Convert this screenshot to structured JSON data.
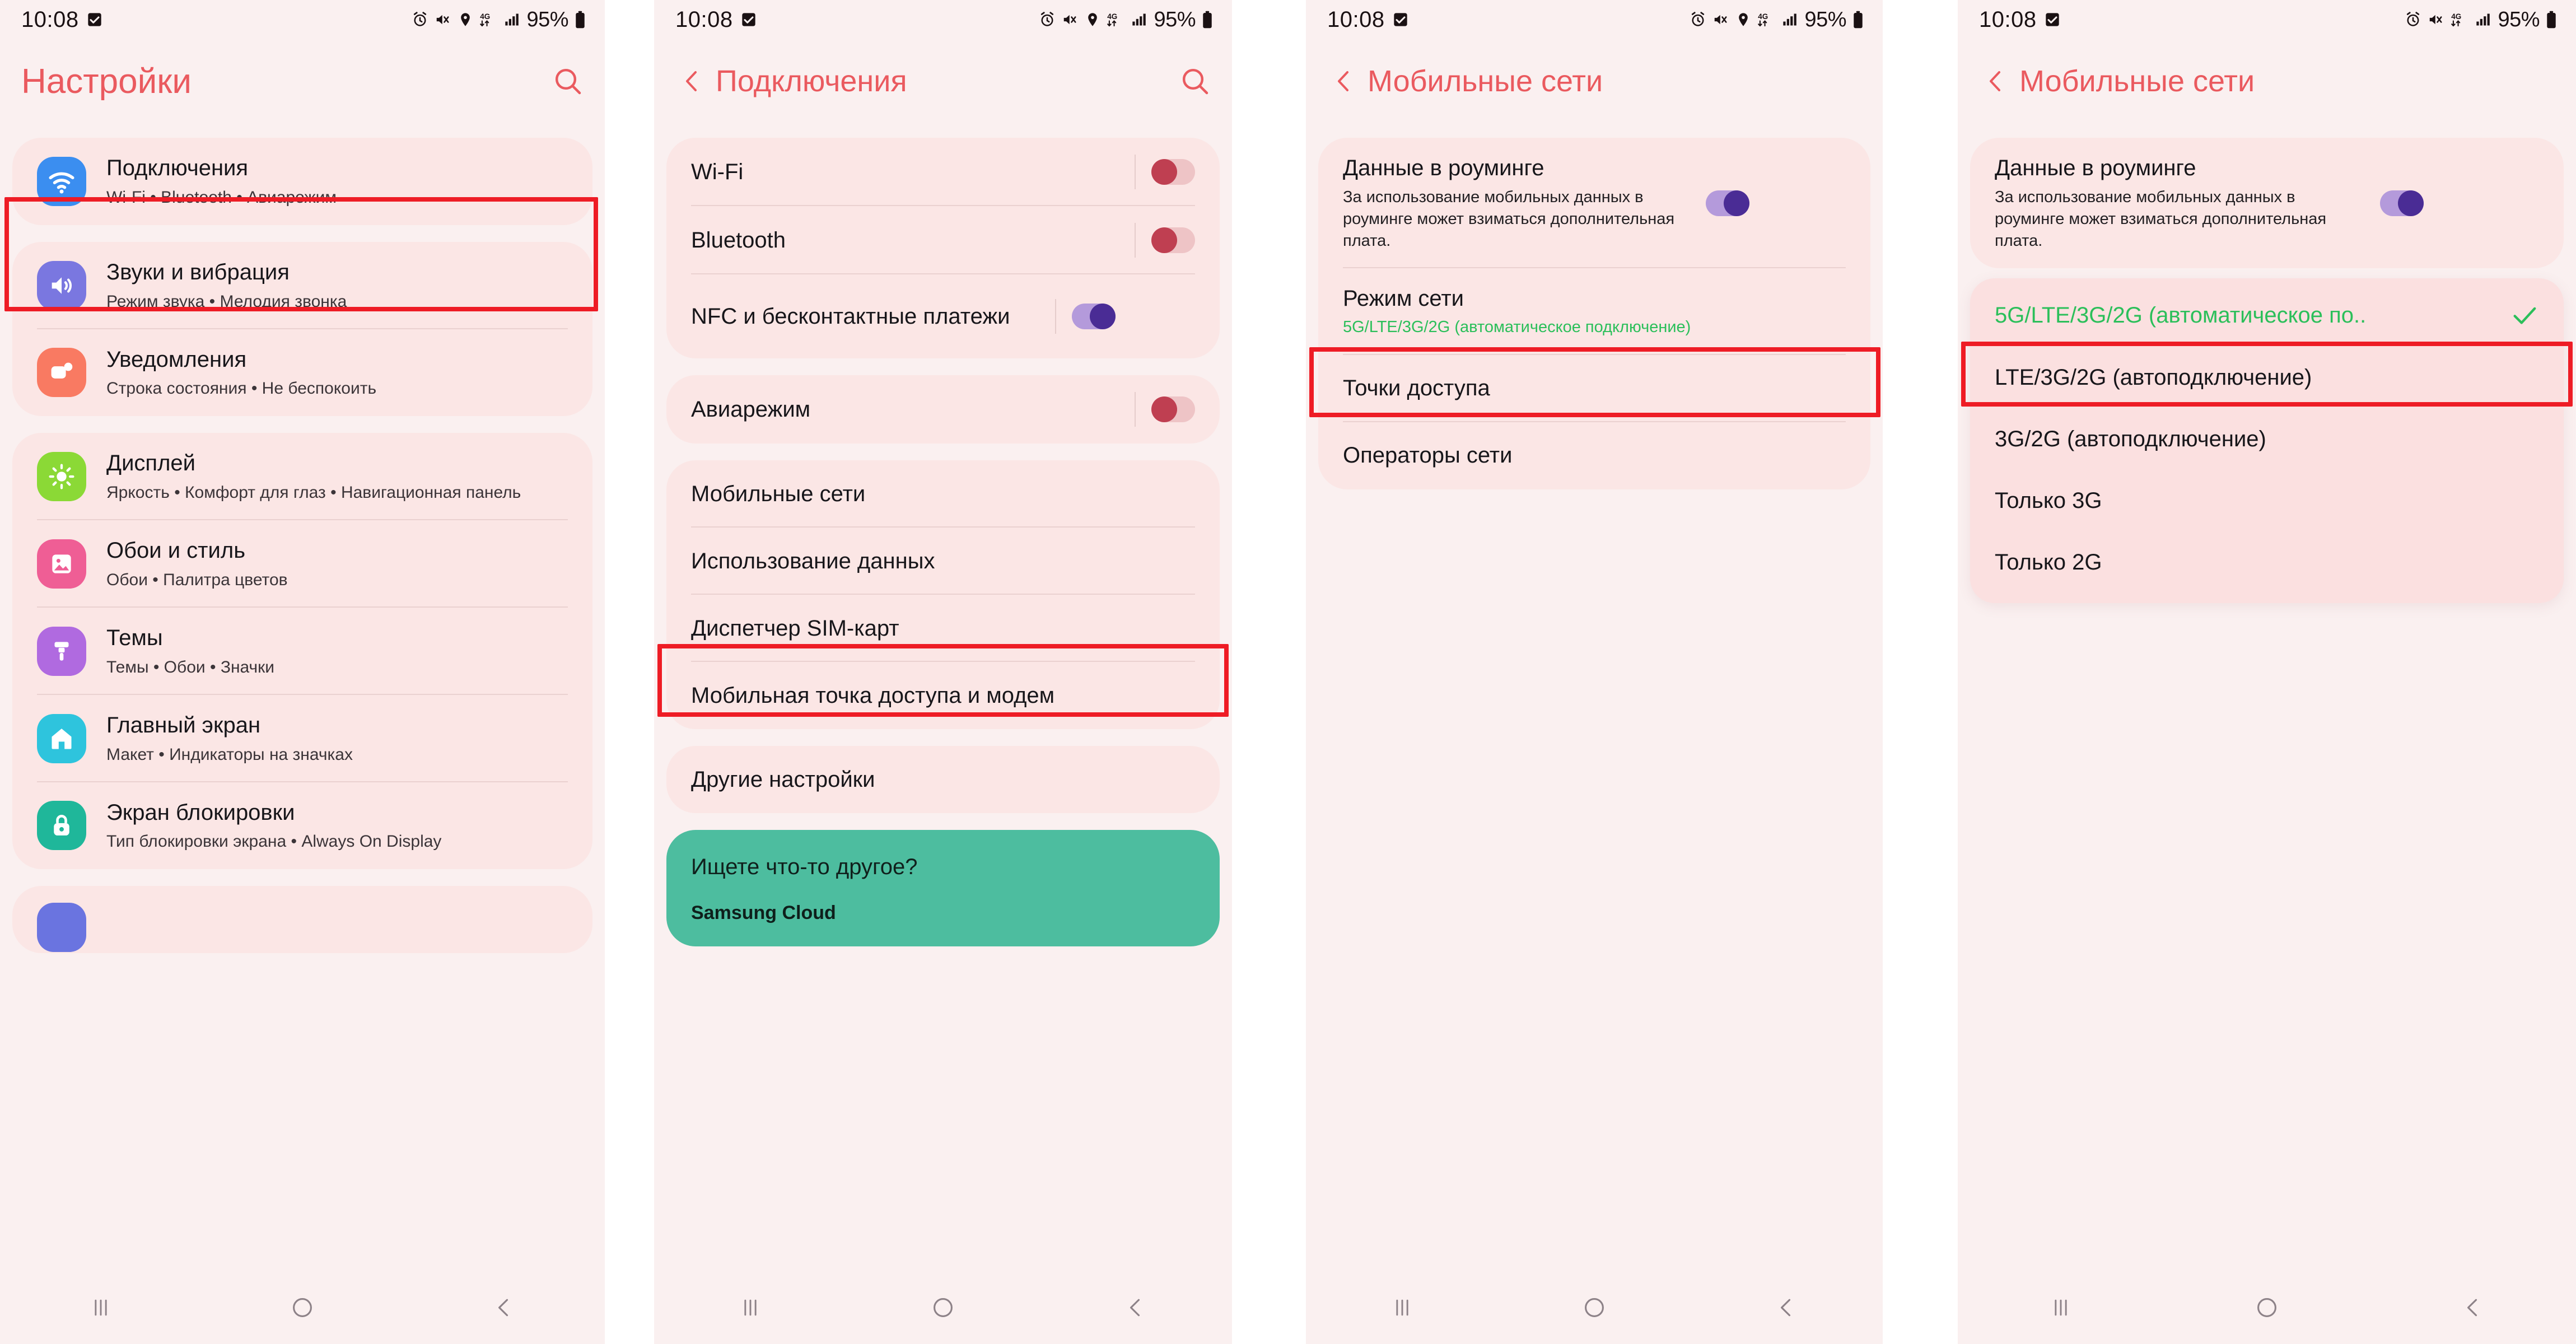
{
  "statusbar": {
    "time": "10:08",
    "battery_percent": "95%",
    "network_type": "4G",
    "icons": [
      "check-box-icon",
      "alarm-icon",
      "mute-vibrate-icon",
      "location-pin-icon",
      "data-transfer-4g-icon",
      "signal-bars-icon",
      "battery-icon"
    ]
  },
  "panel1": {
    "title": "Настройки",
    "search_icon": "search-icon",
    "groups": [
      {
        "items": [
          {
            "title": "Подключения",
            "subtitle": "Wi-Fi  •  Bluetooth  •  Авиарежим",
            "icon": "wifi-icon",
            "icon_color": "#3b8ef0"
          }
        ]
      },
      {
        "items": [
          {
            "title": "Звуки и вибрация",
            "subtitle": "Режим звука  •  Мелодия звонка",
            "icon": "volume-icon",
            "icon_color": "#7a77e0"
          },
          {
            "title": "Уведомления",
            "subtitle": "Строка состояния  •  Не беспокоить",
            "icon": "notification-icon",
            "icon_color": "#f97a62"
          }
        ]
      },
      {
        "items": [
          {
            "title": "Дисплей",
            "subtitle": "Яркость  •  Комфорт для глаз  •  Навигационная панель",
            "icon": "brightness-icon",
            "icon_color": "#8bd936"
          },
          {
            "title": "Обои и стиль",
            "subtitle": "Обои  •  Палитра цветов",
            "icon": "wallpaper-icon",
            "icon_color": "#ef5e95"
          },
          {
            "title": "Темы",
            "subtitle": "Темы  •  Обои  •  Значки",
            "icon": "paintbrush-icon",
            "icon_color": "#b06ae0"
          },
          {
            "title": "Главный экран",
            "subtitle": "Макет  •  Индикаторы на значках",
            "icon": "home-icon",
            "icon_color": "#2ec4dd"
          },
          {
            "title": "Экран блокировки",
            "subtitle": "Тип блокировки экрана  •  Always On Display",
            "icon": "lock-icon",
            "icon_color": "#1fb79a"
          }
        ]
      }
    ]
  },
  "panel2": {
    "title": "Подключения",
    "back_icon": "chevron-left-icon",
    "search_icon": "search-icon",
    "groups": [
      {
        "items": [
          {
            "title": "Wi-Fi",
            "toggle": "off"
          },
          {
            "title": "Bluetooth",
            "toggle": "off"
          },
          {
            "title": "NFC и бесконтактные платежи",
            "toggle": "on"
          }
        ]
      },
      {
        "items": [
          {
            "title": "Авиарежим",
            "toggle": "off"
          }
        ]
      },
      {
        "items": [
          {
            "title": "Мобильные сети"
          },
          {
            "title": "Использование данных"
          },
          {
            "title": "Диспетчер SIM-карт"
          },
          {
            "title": "Мобильная точка доступа и модем"
          }
        ]
      },
      {
        "items": [
          {
            "title": "Другие настройки"
          }
        ]
      }
    ],
    "promo": {
      "title": "Ищете что-то другое?",
      "subtitle": "Samsung Cloud"
    }
  },
  "panel3": {
    "title": "Мобильные сети",
    "back_icon": "chevron-left-icon",
    "groups": [
      {
        "items": [
          {
            "title": "Данные в роуминге",
            "subtitle": "За использование мобильных данных в роуминге может взиматься дополнительная плата.",
            "toggle": "on"
          },
          {
            "title": "Режим сети",
            "subtitle": "5G/LTE/3G/2G (автоматическое подключение)",
            "subtitle_green": true
          },
          {
            "title": "Точки доступа"
          },
          {
            "title": "Операторы сети"
          }
        ]
      }
    ]
  },
  "panel4": {
    "title": "Мобильные сети",
    "back_icon": "chevron-left-icon",
    "roaming": {
      "title": "Данные в роуминге",
      "subtitle": "За использование мобильных данных в роуминге может взиматься дополнительная плата.",
      "toggle": "on"
    },
    "menu": {
      "items": [
        {
          "label": "5G/LTE/3G/2G (автоматическое по..",
          "selected": true,
          "check_icon": "check-icon"
        },
        {
          "label": "LTE/3G/2G (автоподключение)",
          "selected": false
        },
        {
          "label": "3G/2G (автоподключение)",
          "selected": false
        },
        {
          "label": "Только 3G",
          "selected": false
        },
        {
          "label": "Только 2G",
          "selected": false
        }
      ]
    }
  },
  "navbar": {
    "recents_icon": "recents-icon",
    "home_icon": "home-circle-icon",
    "back_icon": "chevron-left-icon"
  },
  "colors": {
    "accent": "#ea5a5f",
    "card_bg": "#fbe6e5",
    "panel_bg": "#faf0f0",
    "annotation": "#ee1c25",
    "green": "#2bbf5a",
    "promo": "#4dbd9f"
  }
}
